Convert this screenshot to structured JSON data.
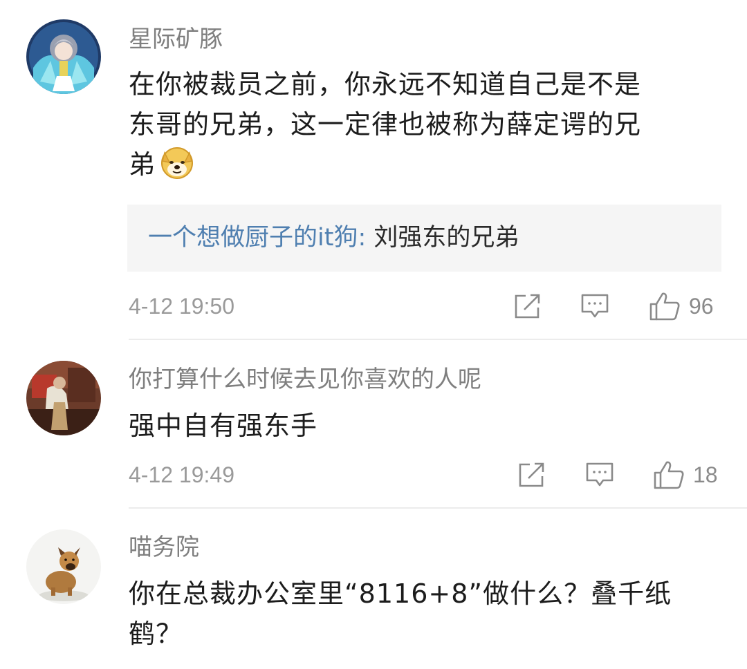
{
  "comments": [
    {
      "username": "星际矿豚",
      "lines": [
        "在你被裁员之前，你永远不知道自己是不是",
        "东哥的兄弟，这一定律也被称为薛定谔的兄",
        "弟"
      ],
      "emoji": "doge-emoji",
      "reply": {
        "name": "一个想做厨子的it狗",
        "colon": ":",
        "text": " 刘强东的兄弟"
      },
      "timestamp": "4-12 19:50",
      "likes": "96"
    },
    {
      "username": "你打算什么时候去见你喜欢的人呢",
      "lines": [
        "强中自有强东手"
      ],
      "timestamp": "4-12 19:49",
      "likes": "18"
    },
    {
      "username": "喵务院",
      "lines": [
        "你在总裁办公室里“8116+8”做什么？叠千纸",
        "鹤？"
      ]
    }
  ],
  "icons": {
    "share": "share-icon",
    "comment": "comment-icon",
    "like": "thumbs-up-icon"
  },
  "colors": {
    "username": "#7f7f7f",
    "reply_name": "#4f7fb0",
    "reply_bg": "#f5f5f5",
    "meta": "#9a9a9a"
  }
}
